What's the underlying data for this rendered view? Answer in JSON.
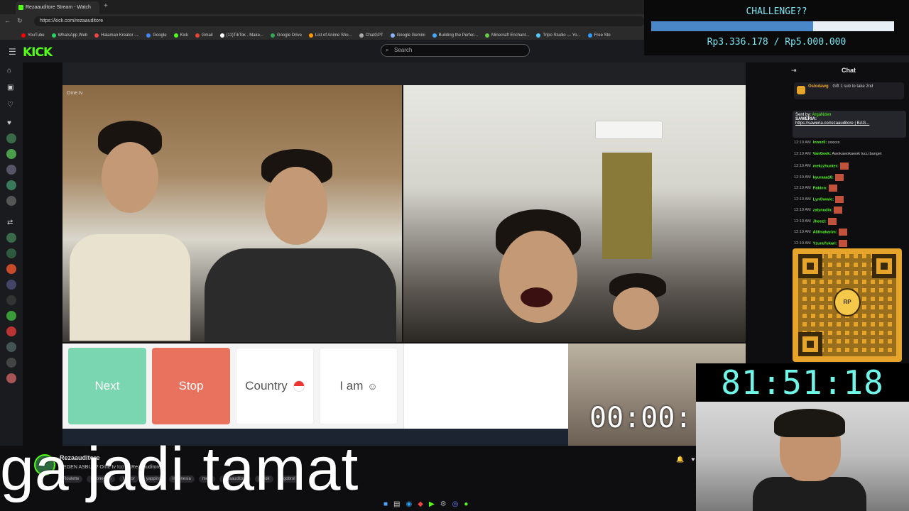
{
  "browser": {
    "tab_title": "Rezaauditore Stream - Watch",
    "url": "https://kick.com/rezaauditore",
    "bookmarks": [
      "YouTube",
      "WhatsApp Web",
      "Halaman Kreator -...",
      "Google",
      "Kick",
      "Gmail",
      "(11)TikTok - Make...",
      "Google Drive",
      "List of Anime Sho...",
      "ChatGPT",
      "Google Gemini",
      "Building the Perfec...",
      "Minecraft Enchant...",
      "Tripo Studio — Yo...",
      "Free Sto"
    ]
  },
  "kick": {
    "logo": "KICK",
    "search_placeholder": "Search"
  },
  "challenge": {
    "title": "CHALLENGE??",
    "amount": "Rp3.336.178 / Rp5.000.000",
    "progress": 0.667,
    "bar_color": "#4a87c9"
  },
  "video": {
    "ometv_label": "Ome.tv",
    "buttons": {
      "next": "Next",
      "stop": "Stop",
      "country": "Country",
      "iam": "I am"
    },
    "pip_timer": "00:00:"
  },
  "chat": {
    "title": "Chat",
    "pinned_user": "Oslodawg",
    "pinned_text": "Gift 1 sub to take 2nd",
    "sent_by_label": "Sent by",
    "sent_by_user": "ArgaNden",
    "saweria_label": "SAWERIA:",
    "saweria_link": "https://saweria.co/rezaauditore | BAG...",
    "messages": [
      {
        "time": "12:19 AM",
        "user": "Innnz0",
        "text": "xxxxxx"
      },
      {
        "time": "12:19 AM",
        "user": "VanGeek",
        "text": "Awokawokawok lucu banget"
      },
      {
        "time": "12:19 AM",
        "user": "mekzzhunter",
        "text": ""
      },
      {
        "time": "12:19 AM",
        "user": "kyuraaa18",
        "text": ""
      },
      {
        "time": "12:19 AM",
        "user": "Pakinn",
        "text": ""
      },
      {
        "time": "12:19 AM",
        "user": "LynOwwie",
        "text": ""
      },
      {
        "time": "12:19 AM",
        "user": "zalynudin",
        "text": ""
      },
      {
        "time": "12:19 AM",
        "user": "Jheezl",
        "text": ""
      },
      {
        "time": "12:19 AM",
        "user": "Alifmakarim",
        "text": ""
      },
      {
        "time": "12:19 AM",
        "user": "YzuraYukari",
        "text": ""
      }
    ]
  },
  "qr": {
    "mascot_label": "RP"
  },
  "timer": "81:51:18",
  "stream_info": {
    "streamer": "Rezaauditore",
    "title": "DEGEN ASBUN? Ome tv !cctv | Rezaauditore",
    "tags": [
      "Roulette",
      "Indonesian",
      "Horror",
      "yapping",
      "Indonesia",
      "meet",
      "rezaauditore",
      "jomok",
      "ngobrol"
    ]
  },
  "overlay_caption": "ga jadi tamat"
}
